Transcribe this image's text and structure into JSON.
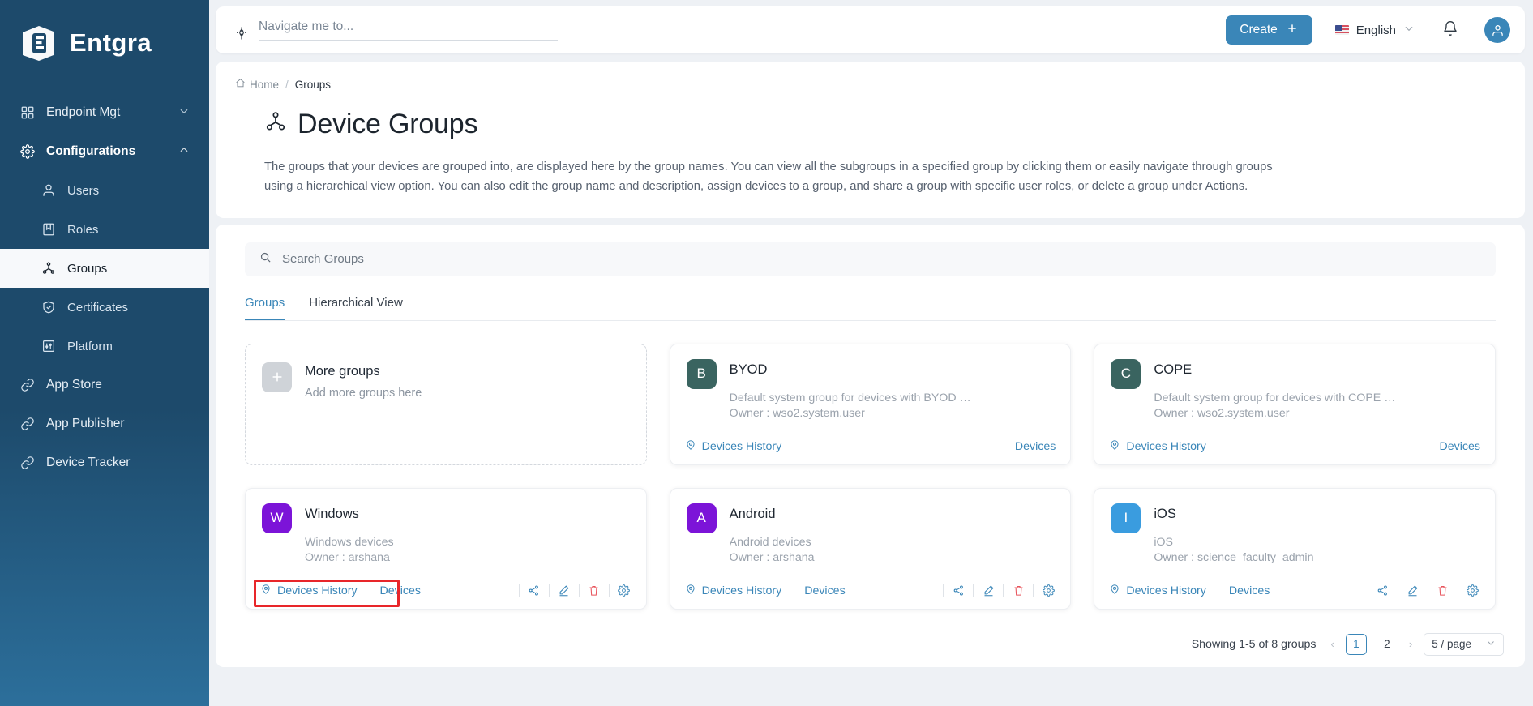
{
  "brand": {
    "name": "Entgra",
    "logo_icon": "entgra-logo-icon"
  },
  "sidebar": {
    "items": [
      {
        "label": "Endpoint Mgt",
        "icon": "grid-icon",
        "chevron": "chevron-down-icon",
        "type": "group"
      },
      {
        "label": "Configurations",
        "icon": "gear-icon",
        "chevron": "chevron-up-icon",
        "type": "group"
      },
      {
        "label": "Users",
        "icon": "user-icon",
        "type": "sub"
      },
      {
        "label": "Roles",
        "icon": "roles-icon",
        "type": "sub"
      },
      {
        "label": "Groups",
        "icon": "groups-icon",
        "type": "sub",
        "active": true
      },
      {
        "label": "Certificates",
        "icon": "shield-check-icon",
        "type": "sub"
      },
      {
        "label": "Platform",
        "icon": "sliders-icon",
        "type": "sub"
      },
      {
        "label": "App Store",
        "icon": "link-icon",
        "type": "group"
      },
      {
        "label": "App Publisher",
        "icon": "link-icon",
        "type": "group"
      },
      {
        "label": "Device Tracker",
        "icon": "link-icon",
        "type": "group"
      }
    ]
  },
  "topbar": {
    "navigate_placeholder": "Navigate me to...",
    "navigate_value": "",
    "navigate_icon": "navigate-target-icon",
    "create_label": "Create",
    "create_plus": "+",
    "language": "English",
    "language_chevron": "chevron-down-icon",
    "bell_icon": "bell-icon",
    "avatar_icon": "user-avatar-icon",
    "accent_color": "#3a86b8"
  },
  "breadcrumb": {
    "home": "Home",
    "separator": "/",
    "current": "Groups",
    "home_icon": "home-icon"
  },
  "page": {
    "title": "Device Groups",
    "title_icon": "groups-icon",
    "description": "The groups that your devices are grouped into, are displayed here by the group names. You can view all the subgroups in a specified group by clicking them or easily navigate through groups using a hierarchical view option. You can also edit the group name and description, assign devices to a group, and share a group with specific user roles, or delete a group under Actions."
  },
  "search": {
    "placeholder": "Search Groups",
    "value": "",
    "icon": "search-icon"
  },
  "tabs": [
    {
      "label": "Groups",
      "active": true
    },
    {
      "label": "Hierarchical View",
      "active": false
    }
  ],
  "more_card": {
    "title": "More groups",
    "subtitle": "Add more groups here",
    "plus": "+",
    "plus_icon": "plus-icon"
  },
  "labels": {
    "devices_history": "Devices History",
    "devices": "Devices",
    "location_icon": "location-pin-icon",
    "share_icon": "share-icon",
    "edit_icon": "pencil-edit-icon",
    "delete_icon": "trash-delete-icon",
    "settings_icon": "gear-settings-icon"
  },
  "colors": {
    "accent": "#3a86b8",
    "danger": "#e8262a",
    "byod_avatar": "#3a6460",
    "cope_avatar": "#3a6460",
    "windows_avatar": "#7c14d8",
    "android_avatar": "#7c14d8",
    "ios_avatar": "#3a9cdf",
    "highlight": "#e8262a"
  },
  "groups": [
    {
      "initial": "B",
      "name": "BYOD",
      "description": "Default system group for devices with BYOD owne...",
      "owner": "Owner : wso2.system.user",
      "avatar_color": "#3a6460",
      "has_icons": false,
      "highlighted": false
    },
    {
      "initial": "C",
      "name": "COPE",
      "description": "Default system group for devices with COPE owne...",
      "owner": "Owner : wso2.system.user",
      "avatar_color": "#3a6460",
      "has_icons": false,
      "highlighted": false
    },
    {
      "initial": "W",
      "name": "Windows",
      "description": "Windows devices",
      "owner": "Owner : arshana",
      "avatar_color": "#7c14d8",
      "has_icons": true,
      "highlighted": true
    },
    {
      "initial": "A",
      "name": "Android",
      "description": "Android devices",
      "owner": "Owner : arshana",
      "avatar_color": "#7c14d8",
      "has_icons": true,
      "highlighted": false
    },
    {
      "initial": "I",
      "name": "iOS",
      "description": "iOS",
      "owner": "Owner : science_faculty_admin",
      "avatar_color": "#3a9cdf",
      "has_icons": true,
      "highlighted": false
    }
  ],
  "pagination": {
    "info": "Showing 1-5 of 8 groups",
    "prev": "‹",
    "next": "›",
    "pages": [
      "1",
      "2"
    ],
    "current_page": "1",
    "page_size": "5 / page",
    "page_size_chevron": "chevron-down-icon"
  }
}
